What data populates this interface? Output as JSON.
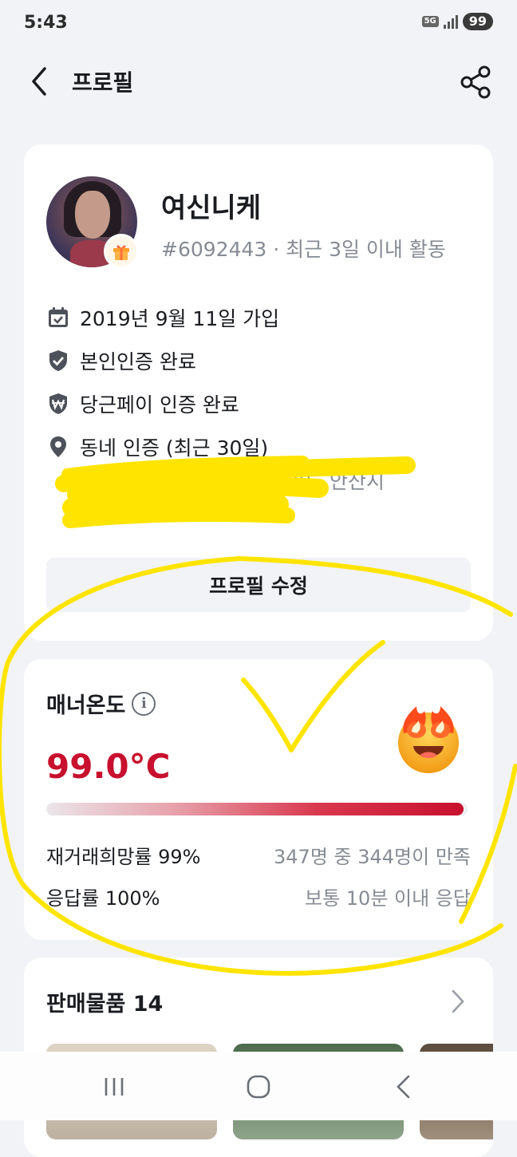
{
  "status_bar": {
    "time": "5:43",
    "network": "5G",
    "battery": "99"
  },
  "header": {
    "title": "프로필"
  },
  "profile": {
    "nickname": "여신니케",
    "meta": "#6092443 · 최근 3일 이내 활동",
    "join_date": "2019년 9월 11일 가입",
    "identity": "본인인증 완료",
    "pay_verified": "당근페이 인증 완료",
    "neighborhood": "동네 인증 (최근 30일)",
    "neighborhood_detail": "경기도 안산시",
    "edit_button": "프로필 수정"
  },
  "manner": {
    "title": "매너온도",
    "temperature": "99.0°C",
    "temperature_level": 99.0,
    "rehire_label": "재거래희망률 99%",
    "rehire_desc": "347명 중 344명이 만족",
    "response_label": "응답률 100%",
    "response_desc": "보통 10분 이내 응답",
    "accent_color": "#c8102e"
  },
  "sales": {
    "title": "판매물품 14"
  },
  "icons": [
    "back-icon",
    "share-icon",
    "gift-icon",
    "calendar-icon",
    "shield-check-icon",
    "won-shield-icon",
    "location-pin-icon",
    "info-icon",
    "fire-face-emoji",
    "chevron-right-icon",
    "recent-apps-icon",
    "home-icon",
    "nav-back-icon"
  ]
}
